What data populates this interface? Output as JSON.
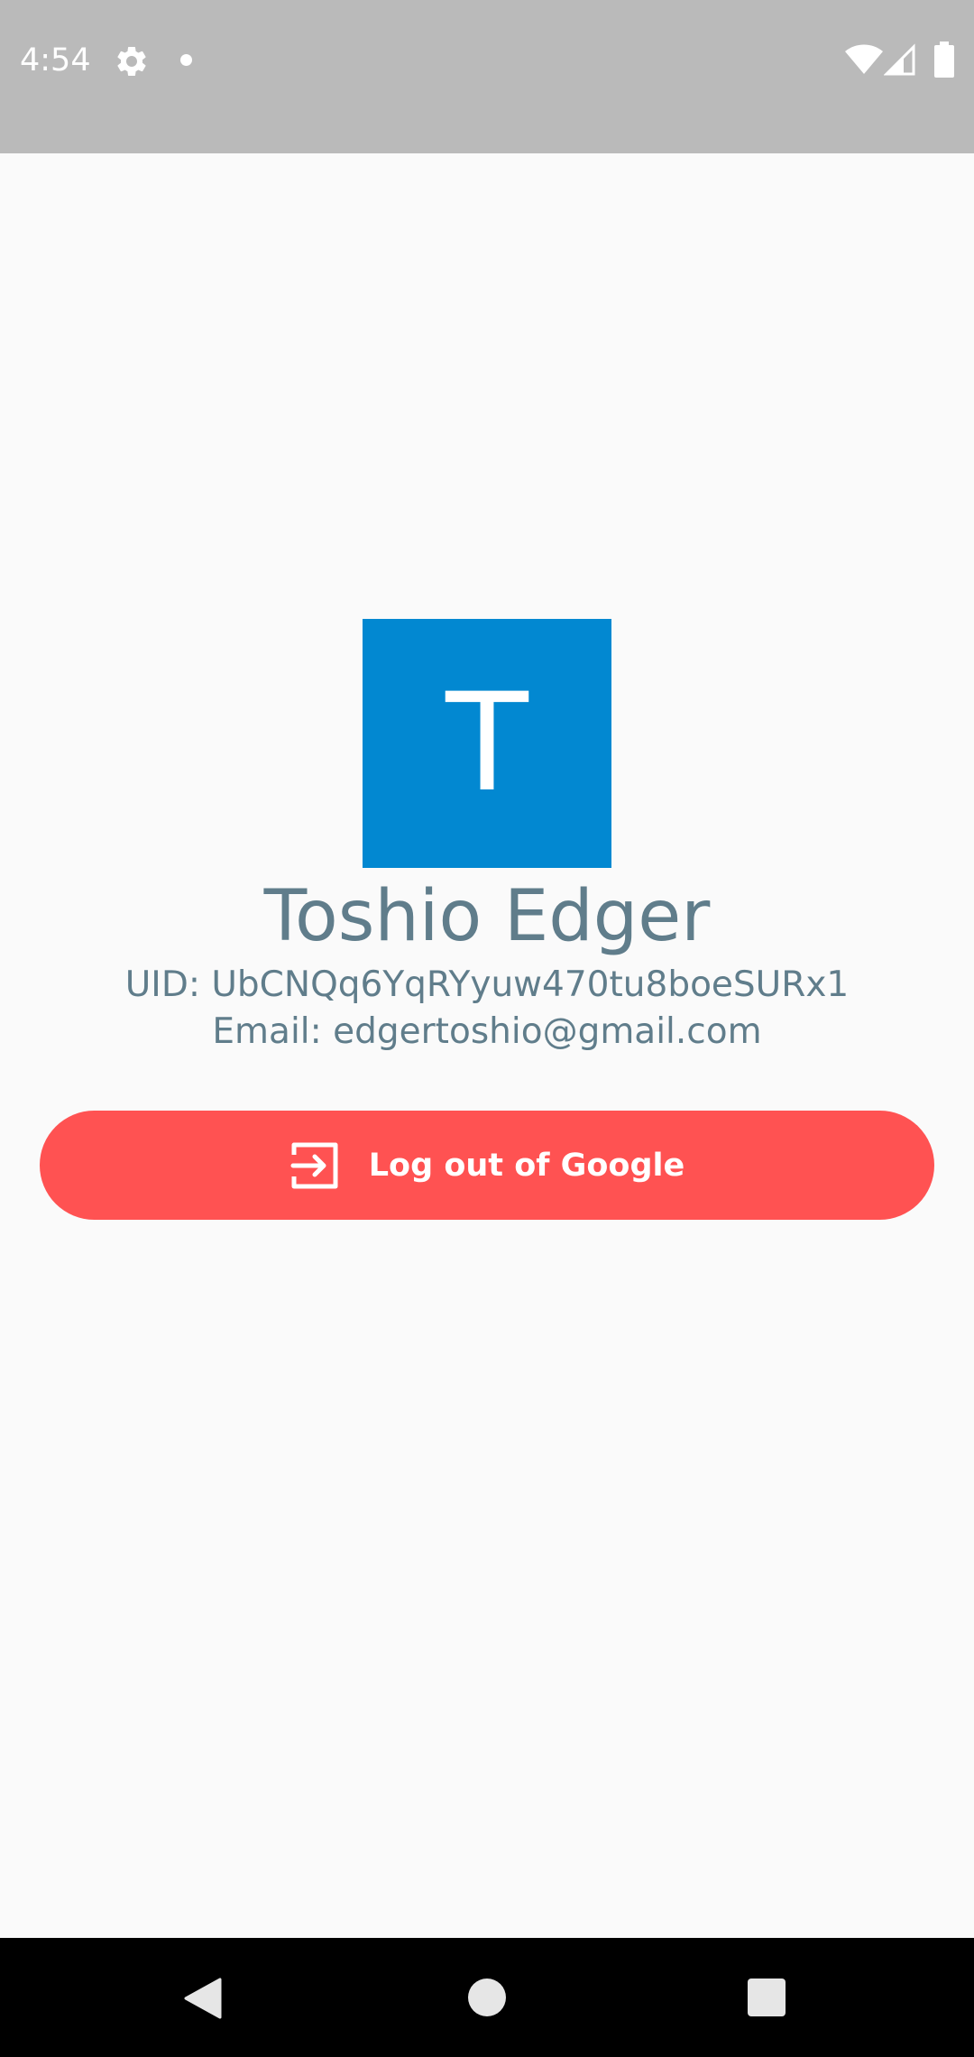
{
  "status_bar": {
    "time": "4:54",
    "icons": [
      "gear-icon",
      "notification-dot-icon",
      "wifi-icon",
      "cellular-signal-icon",
      "battery-icon"
    ]
  },
  "profile": {
    "avatar_letter": "T",
    "avatar_color": "#0288d1",
    "name": "Toshio Edger",
    "uid": "UID: UbCNQq6YqRYyuw470tu8boeSURx1",
    "email": "Email: edgertoshio@gmail.com",
    "text_color": "#607d8b"
  },
  "logout": {
    "label": "Log out of Google",
    "icon": "logout-icon",
    "color": "#ff5252"
  },
  "nav_bar": {
    "icons": [
      "back-icon",
      "home-icon",
      "recents-icon"
    ]
  }
}
